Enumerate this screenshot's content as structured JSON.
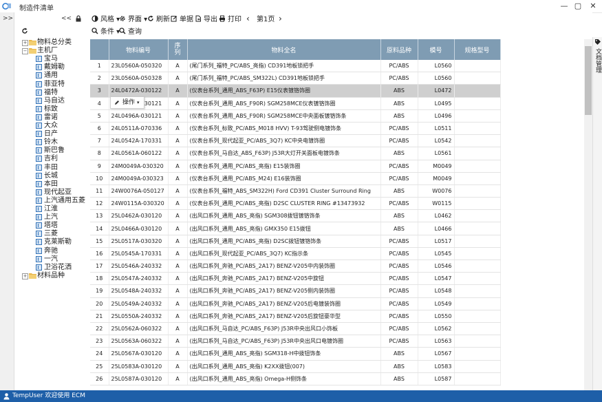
{
  "window": {
    "title": "制造件清单"
  },
  "sidebar": {
    "collapse_label": "<<",
    "rail_expand_label": ">>",
    "tree": [
      {
        "label": "物料总分类",
        "level": 0,
        "expander": "+",
        "type": "folder"
      },
      {
        "label": "主机厂",
        "level": 0,
        "expander": "−",
        "type": "folder"
      },
      {
        "label": "宝马",
        "level": 1,
        "type": "leaf"
      },
      {
        "label": "戴姆勒",
        "level": 1,
        "type": "leaf"
      },
      {
        "label": "通用",
        "level": 1,
        "type": "leaf"
      },
      {
        "label": "菲亚特",
        "level": 1,
        "type": "leaf"
      },
      {
        "label": "福特",
        "level": 1,
        "type": "leaf"
      },
      {
        "label": "马自达",
        "level": 1,
        "type": "leaf"
      },
      {
        "label": "标致",
        "level": 1,
        "type": "leaf"
      },
      {
        "label": "雷诺",
        "level": 1,
        "type": "leaf"
      },
      {
        "label": "大众",
        "level": 1,
        "type": "leaf"
      },
      {
        "label": "日产",
        "level": 1,
        "type": "leaf"
      },
      {
        "label": "铃木",
        "level": 1,
        "type": "leaf"
      },
      {
        "label": "斯巴鲁",
        "level": 1,
        "type": "leaf"
      },
      {
        "label": "吉利",
        "level": 1,
        "type": "leaf"
      },
      {
        "label": "丰田",
        "level": 1,
        "type": "leaf"
      },
      {
        "label": "长城",
        "level": 1,
        "type": "leaf"
      },
      {
        "label": "本田",
        "level": 1,
        "type": "leaf"
      },
      {
        "label": "现代起亚",
        "level": 1,
        "type": "leaf"
      },
      {
        "label": "上汽通用五菱",
        "level": 1,
        "type": "leaf"
      },
      {
        "label": "江淮",
        "level": 1,
        "type": "leaf"
      },
      {
        "label": "上汽",
        "level": 1,
        "type": "leaf"
      },
      {
        "label": "塔塔",
        "level": 1,
        "type": "leaf"
      },
      {
        "label": "三菱",
        "level": 1,
        "type": "leaf"
      },
      {
        "label": "克莱斯勒",
        "level": 1,
        "type": "leaf"
      },
      {
        "label": "奔驰",
        "level": 1,
        "type": "leaf"
      },
      {
        "label": "一汽",
        "level": 1,
        "type": "leaf"
      },
      {
        "label": "卫浴花洒",
        "level": 1,
        "type": "leaf"
      },
      {
        "label": "材料品种",
        "level": 0,
        "expander": "+",
        "type": "folder"
      }
    ]
  },
  "toolbar": {
    "style_label": "风格",
    "ui_label": "界面",
    "refresh_label": "刷新",
    "doc_label": "单据",
    "export_label": "导出",
    "print_label": "打印",
    "prev_label": "‹",
    "page_label": "第1页",
    "next_label": "›",
    "filter_label": "条件",
    "query_label": "查询"
  },
  "grid": {
    "columns": [
      "",
      "物料编号",
      "序列",
      "物料全名",
      "原料品种",
      "模号",
      "规格型号"
    ],
    "selected_row": 2,
    "row_menu_label": "操作",
    "rows": [
      [
        "1",
        "23L0560A-050320",
        "A",
        "(尾门系列_福特_PC/ABS_亮指) CD391地板锁把手",
        "PC/ABS",
        "L0560",
        ""
      ],
      [
        "2",
        "23L0560A-050328",
        "A",
        "(尾门系列_福特_PC/ABS_SM322L) CD391地板锁把手",
        "PC/ABS",
        "L0560",
        ""
      ],
      [
        "3",
        "24L0472A-030122",
        "A",
        "(仪表台系列_通用_ABS_F63P) E15仪表镀铬饰圈",
        "ABS",
        "L0472",
        ""
      ],
      [
        "4",
        "24L0495A-030121",
        "A",
        "(仪表台系列_通用_ABS_F90R) SGM258MCE仪表镀铬饰圈",
        "ABS",
        "L0495",
        ""
      ],
      [
        "5",
        "24L0496A-030121",
        "A",
        "(仪表台系列_通用_ABS_F90R) SGM258MCE中央面板镀铬饰条",
        "ABS",
        "L0496",
        ""
      ],
      [
        "6",
        "24L0511A-070336",
        "A",
        "(仪表台系列_标致_PC/ABS_M018 HVV) T-93驾驶侧电镀饰条",
        "PC/ABS",
        "L0511",
        ""
      ],
      [
        "7",
        "24L0542A-170331",
        "A",
        "(仪表台系列_现代起亚_PC/ABS_3Q7) KC中央电镀饰圈",
        "PC/ABS",
        "L0542",
        ""
      ],
      [
        "8",
        "24L0561A-060122",
        "A",
        "(仪表台系列_马自达_ABS_F63P) J53R大灯开关面板电镀饰条",
        "ABS",
        "L0561",
        ""
      ],
      [
        "9",
        "24M0049A-030320",
        "A",
        "(仪表台系列_通用_PC/ABS_亮指) E15装饰圈",
        "PC/ABS",
        "M0049",
        ""
      ],
      [
        "10",
        "24M0049A-030323",
        "A",
        "(仪表台系列_通用_PC/ABS_M24) E16装饰圈",
        "PC/ABS",
        "M0049",
        ""
      ],
      [
        "11",
        "24W0076A-050127",
        "A",
        "(仪表台系列_福特_ABS_SM322H) Ford CD391 Cluster Surround Ring",
        "ABS",
        "W0076",
        ""
      ],
      [
        "12",
        "24W0115A-030320",
        "A",
        "(仪表台系列_通用_PC/ABS_亮指) D2SC CLUSTER RING #13473932",
        "PC/ABS",
        "W0115",
        ""
      ],
      [
        "13",
        "25L0462A-030120",
        "A",
        "(出风口系列_通用_ABS_亮指) SGM308拨钮镀铬饰条",
        "ABS",
        "L0462",
        ""
      ],
      [
        "14",
        "25L0466A-030120",
        "A",
        "(出风口系列_通用_ABS_亮指) GMX350 E15拨钮",
        "ABS",
        "L0466",
        ""
      ],
      [
        "15",
        "25L0517A-030320",
        "A",
        "(出风口系列_通用_PC/ABS_亮指) D2SC拨钮镀铬饰条",
        "PC/ABS",
        "L0517",
        ""
      ],
      [
        "16",
        "25L0545A-170331",
        "A",
        "(出风口系列_现代起亚_PC/ABS_3Q7) KC指示条",
        "PC/ABS",
        "L0545",
        ""
      ],
      [
        "17",
        "25L0546A-240332",
        "A",
        "(出风口系列_奔驰_PC/ABS_2A17) BENZ-V205中内装饰圈",
        "PC/ABS",
        "L0546",
        ""
      ],
      [
        "18",
        "25L0547A-240332",
        "A",
        "(出风口系列_奔驰_PC/ABS_2A17) BENZ-V205中旋钮",
        "PC/ABS",
        "L0547",
        ""
      ],
      [
        "19",
        "25L0548A-240332",
        "A",
        "(出风口系列_奔驰_PC/ABS_2A17) BENZ-V205侧内装饰圈",
        "PC/ABS",
        "L0548",
        ""
      ],
      [
        "20",
        "25L0549A-240332",
        "A",
        "(出风口系列_奔驰_PC/ABS_2A17) BENZ-V205后电镀装饰圈",
        "PC/ABS",
        "L0549",
        ""
      ],
      [
        "21",
        "25L0550A-240332",
        "A",
        "(出风口系列_奔驰_PC/ABS_2A17) BENZ-V205后旋钮豪华型",
        "PC/ABS",
        "L0550",
        ""
      ],
      [
        "22",
        "25L0562A-060322",
        "A",
        "(出风口系列_马自达_PC/ABS_F63P) J53R中央出风口小饰板",
        "PC/ABS",
        "L0562",
        ""
      ],
      [
        "23",
        "25L0563A-060322",
        "A",
        "(出风口系列_马自达_PC/ABS_F63P) J53R中央出风口电镀饰圈",
        "PC/ABS",
        "L0563",
        ""
      ],
      [
        "24",
        "25L0567A-030120",
        "A",
        "(出风口系列_通用_ABS_亮指) SGM318-H中拨钮饰条",
        "ABS",
        "L0567",
        ""
      ],
      [
        "25",
        "25L0583A-030120",
        "A",
        "(出风口系列_通用_ABS_亮指) K2XX拨钮(007)",
        "ABS",
        "L0583",
        ""
      ],
      [
        "26",
        "25L0587A-030120",
        "A",
        "(出风口系列_通用_ABS_亮指) Omega-H侧饰条",
        "ABS",
        "L0587",
        ""
      ]
    ]
  },
  "right_panel": {
    "doc_tab_label": "文档管理"
  },
  "statusbar": {
    "text": "TempUser  欢迎使用 ECM"
  },
  "colors": {
    "header": "#7f9cb3",
    "selected_row": "#cfcfcf",
    "status_bar": "#1e5fa8",
    "folder": "#e8b64a"
  }
}
